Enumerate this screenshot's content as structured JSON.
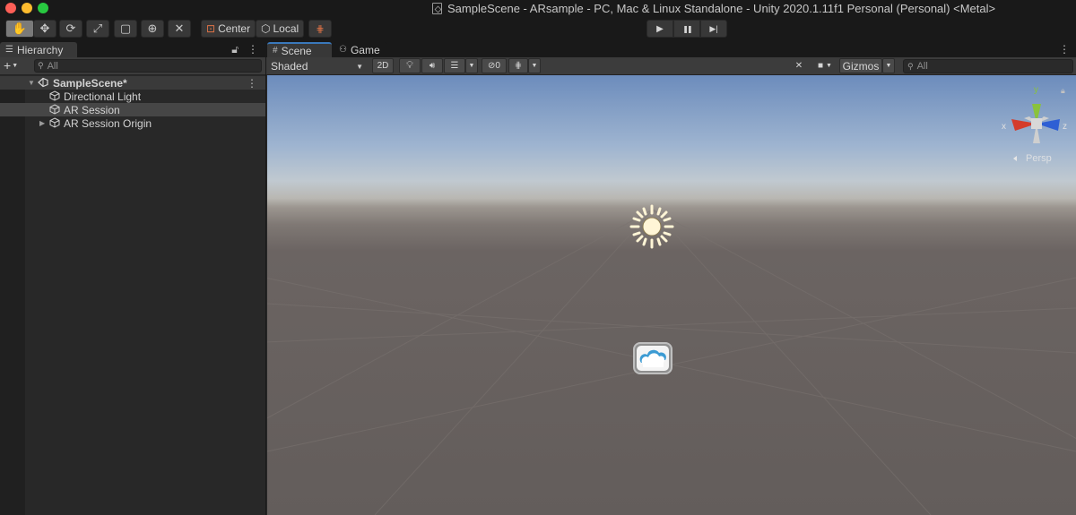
{
  "window": {
    "title": "SampleScene - ARsample - PC, Mac & Linux Standalone - Unity 2020.1.11f1 Personal (Personal) <Metal>"
  },
  "toolbar": {
    "tools": [
      {
        "name": "hand-tool",
        "glyph": "✋"
      },
      {
        "name": "move-tool",
        "glyph": "✥"
      },
      {
        "name": "rotate-tool",
        "glyph": "⟳"
      },
      {
        "name": "scale-tool",
        "glyph": "⤢"
      },
      {
        "name": "rect-tool",
        "glyph": "▢"
      },
      {
        "name": "transform-tool",
        "glyph": "⊕"
      },
      {
        "name": "custom-tool",
        "glyph": "✕"
      }
    ],
    "pivot_label": "Center",
    "space_label": "Local",
    "grid_snap_icon": "grid-snap-icon",
    "play_icon": "▶",
    "pause_icon": "❚❚",
    "step_icon": "▶|"
  },
  "hierarchy": {
    "tab_label": "Hierarchy",
    "add_label": "+",
    "search_placeholder": "All",
    "scene_name": "SampleScene*",
    "items": [
      {
        "label": "Directional Light",
        "expandable": false,
        "highlighted": false
      },
      {
        "label": "AR Session",
        "expandable": false,
        "highlighted": true
      },
      {
        "label": "AR Session Origin",
        "expandable": true,
        "highlighted": false
      }
    ]
  },
  "scene_view": {
    "tabs": [
      {
        "label": "Scene",
        "icon": "#",
        "active": true
      },
      {
        "label": "Game",
        "icon": "⚇",
        "active": false
      }
    ],
    "shading_mode": "Shaded",
    "mode_2d_label": "2D",
    "hidden_count": "0",
    "gizmos_label": "Gizmos",
    "search_placeholder": "All",
    "projection_label": "Persp",
    "axis_labels": {
      "y": "y",
      "x": "x",
      "z": "z"
    },
    "colors": {
      "axis_y": "#8ac23c",
      "axis_x": "#d43c2c",
      "axis_z": "#2e5fd4",
      "sun": "#fff5d6",
      "camera_accent": "#3c9bd3"
    }
  }
}
